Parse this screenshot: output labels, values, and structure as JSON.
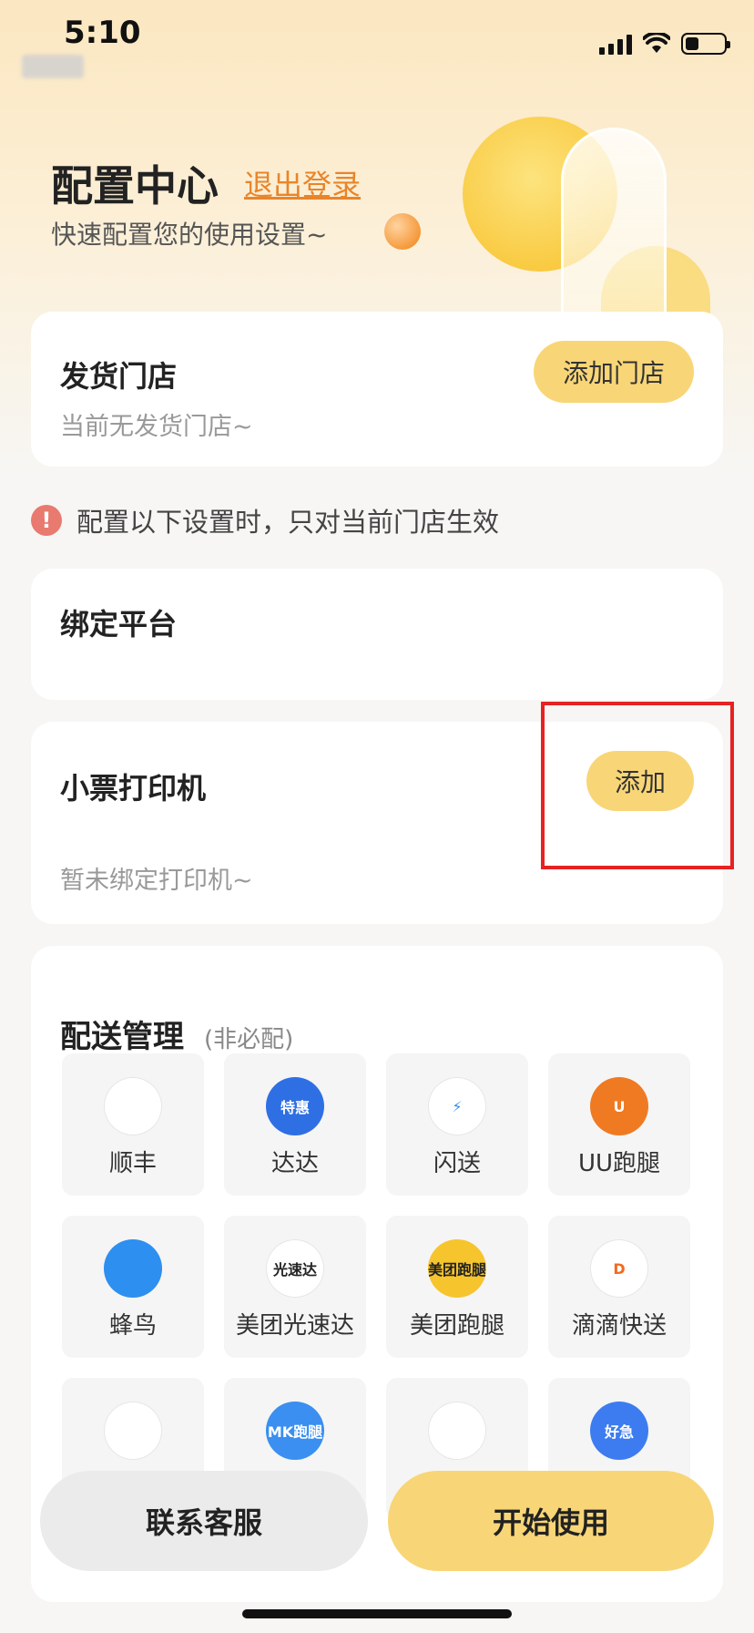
{
  "status": {
    "time": "5:10"
  },
  "header": {
    "title": "配置中心",
    "logout": "退出登录",
    "subtitle": "快速配置您的使用设置~"
  },
  "store_card": {
    "title": "发货门店",
    "empty_text": "当前无发货门店~",
    "add_button": "添加门店"
  },
  "notice": {
    "icon": "!",
    "text": "配置以下设置时，只对当前门店生效"
  },
  "platform_card": {
    "title": "绑定平台"
  },
  "printer_card": {
    "title": "小票打印机",
    "add_button": "添加",
    "empty_text": "暂未绑定打印机~"
  },
  "delivery": {
    "title": "配送管理",
    "optional": "(非必配)",
    "items": [
      {
        "label": "顺丰",
        "icon": "sf-icon",
        "color": "#ffffff",
        "glyph": "",
        "fg": "#111111"
      },
      {
        "label": "达达",
        "icon": "dada-icon",
        "color": "#2f6fe4",
        "glyph": "特惠",
        "fg": "#ffffff"
      },
      {
        "label": "闪送",
        "icon": "shansong-icon",
        "color": "#ffffff",
        "glyph": "⚡",
        "fg": "#2f8ff0"
      },
      {
        "label": "UU跑腿",
        "icon": "uu-icon",
        "color": "#f07a22",
        "glyph": "U",
        "fg": "#ffffff"
      },
      {
        "label": "蜂鸟",
        "icon": "fengniao-icon",
        "color": "#2d8ff0",
        "glyph": "",
        "fg": "#ffffff"
      },
      {
        "label": "美团光速达",
        "icon": "meituan-gsd-icon",
        "color": "#ffffff",
        "glyph": "光速达",
        "fg": "#222222"
      },
      {
        "label": "美团跑腿",
        "icon": "meituan-paotui-icon",
        "color": "#f6c52d",
        "glyph": "美团跑腿",
        "fg": "#222222"
      },
      {
        "label": "滴滴快送",
        "icon": "didi-icon",
        "color": "#ffffff",
        "glyph": "D",
        "fg": "#f26a1e"
      },
      {
        "label": "",
        "icon": "courier-icon",
        "color": "#ffffff",
        "glyph": "",
        "fg": "#2d8ff0"
      },
      {
        "label": "",
        "icon": "mk-icon",
        "color": "#3a8ff0",
        "glyph": "MK跑腿",
        "fg": "#ffffff"
      },
      {
        "label": "",
        "icon": "bag-icon",
        "color": "#ffffff",
        "glyph": "",
        "fg": "#222222"
      },
      {
        "label": "",
        "icon": "haoji-icon",
        "color": "#3d7cf0",
        "glyph": "好急",
        "fg": "#ffffff"
      }
    ]
  },
  "footer": {
    "contact": "联系客服",
    "start": "开始使用"
  }
}
